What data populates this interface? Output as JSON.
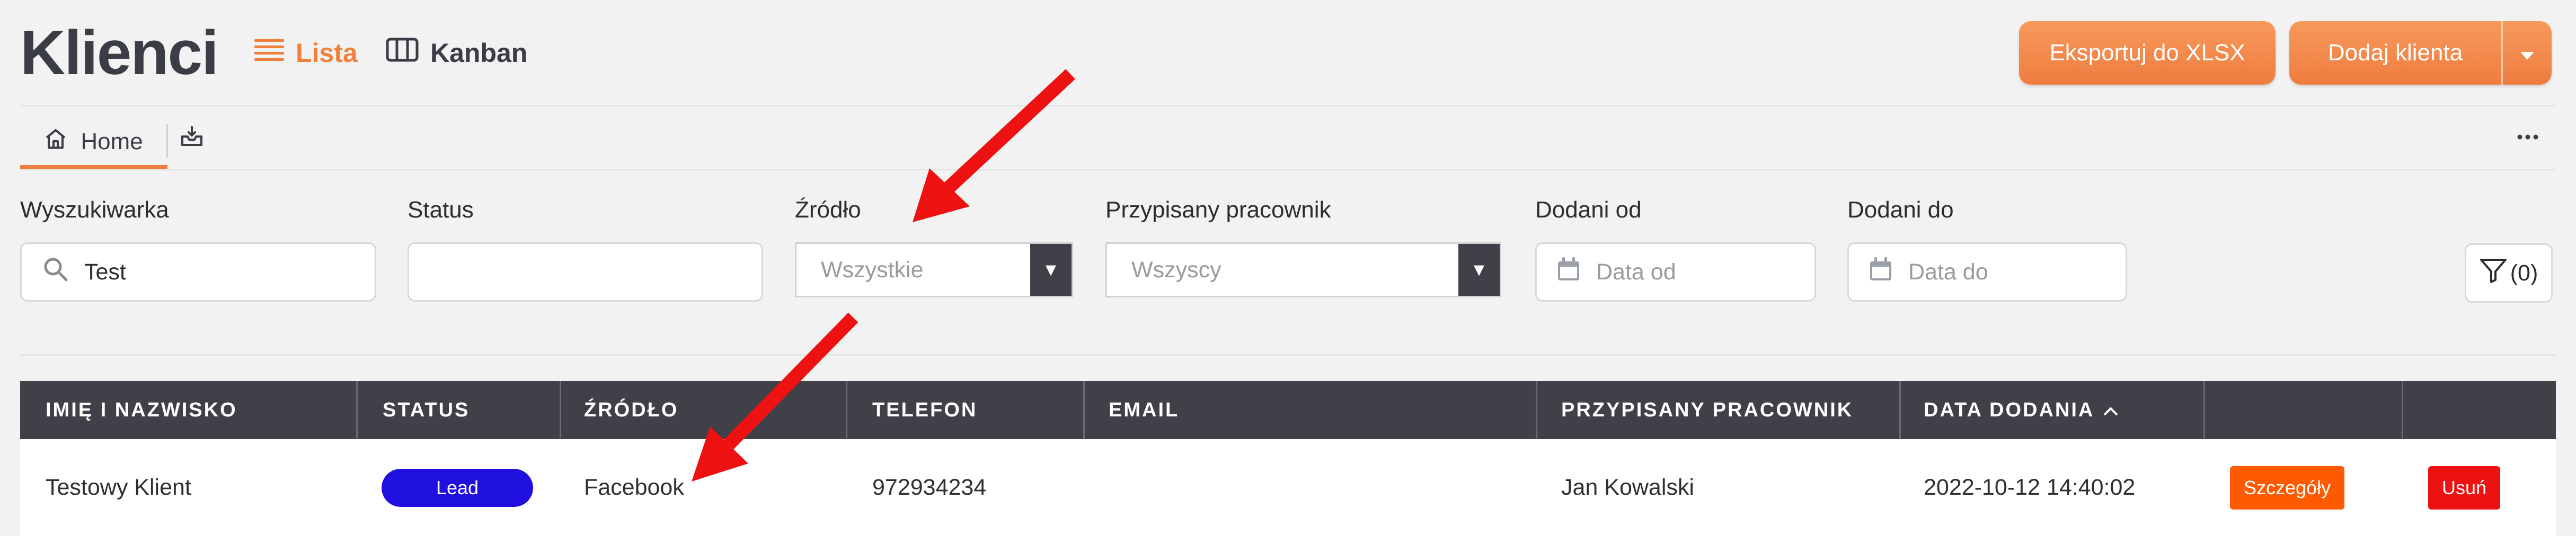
{
  "header": {
    "title": "Klienci",
    "views": [
      {
        "label": "Lista",
        "icon": "list-icon"
      },
      {
        "label": "Kanban",
        "icon": "kanban-icon"
      }
    ],
    "export_label": "Eksportuj do XLSX",
    "add_client_label": "Dodaj klienta"
  },
  "tabs": {
    "home_label": "Home"
  },
  "filters": {
    "search": {
      "label": "Wyszukiwarka",
      "value": "Test"
    },
    "status": {
      "label": "Status",
      "value": ""
    },
    "source": {
      "label": "Źródło",
      "placeholder": "Wszystkie"
    },
    "employee": {
      "label": "Przypisany pracownik",
      "placeholder": "Wszyscy"
    },
    "date_from": {
      "label": "Dodani od",
      "placeholder": "Data od"
    },
    "date_to": {
      "label": "Dodani do",
      "placeholder": "Data do"
    },
    "filter_count": "(0)"
  },
  "table": {
    "columns": [
      "IMIĘ I NAZWISKO",
      "STATUS",
      "ŹRÓDŁO",
      "TELEFON",
      "EMAIL",
      "PRZYPISANY PRACOWNIK",
      "DATA DODANIA"
    ],
    "rows": [
      {
        "name": "Testowy Klient",
        "status": "Lead",
        "source": "Facebook",
        "phone": "972934234",
        "email": "",
        "employee": "Jan Kowalski",
        "date_added": "2022-10-12 14:40:02",
        "details_label": "Szczegóły",
        "delete_label": "Usuń"
      }
    ]
  },
  "colors": {
    "accent": "#f07f3c",
    "header_dark": "#3f4048",
    "badge_blue": "#2010e0",
    "details_orange": "#ff5a00",
    "delete_red": "#ee1111",
    "annotation_arrow": "#ee1111"
  }
}
